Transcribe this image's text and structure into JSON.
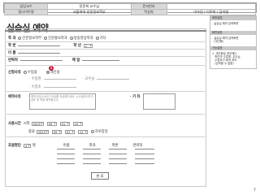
{
  "header": {
    "r1": [
      "담당교수",
      "장윤희 교수님",
      "문서번호",
      ""
    ],
    "r2": [
      "협사이트명",
      "서울여대 인문정보학부",
      "작성자",
      "이수민 / 이주희 / 김미영"
    ]
  },
  "title": "실습실 예약",
  "form": {
    "school_label": "학 과",
    "school_opts": [
      "인문정보학부",
      "인문홍보학과",
      "방송영상학과",
      "기타"
    ],
    "stuno_label": "학 번",
    "grade_label": "학 년",
    "grade_value": "2",
    "name_label": "이 름",
    "phone_label": "연락처",
    "email_label": "메 일",
    "type_label": "신청사유",
    "type_opts": [
      "수업용",
      "개인용"
    ],
    "badge_num": "1",
    "course_label": "· 수업명",
    "prof_label": "· 교수님",
    "course2_label": "· 수업조",
    "reason_label": "예약사유",
    "reason_placeholder": "예약사유(200자 이내)를 작성해주세요. 시스템관리자가 검토 후 최종 예약됩니다.",
    "etc_label": "· 기 타",
    "time_label": "사용시간",
    "start_label": "시작",
    "start_vals": [
      "2013",
      "09",
      "01",
      "10"
    ],
    "end_label": "종료",
    "end_vals": [
      "2013",
      "09",
      "01",
      "12"
    ],
    "allday_label": "하루종일",
    "people_label": "조원명단",
    "people_count": "4",
    "people_unit": "명",
    "people_cols": [
      "이름",
      "학과",
      "학번",
      "연락처"
    ],
    "ok_label": "완 료"
  },
  "side": {
    "h1": "화면설명",
    "b1": "- 실습실 예약 입력화면",
    "h2": "화면설명",
    "b2": "- 실습실 예약 입력화면\n  (개인용)",
    "h3": "기능설명",
    "b3": "1. 개인용일 경우에는\n   학단의 수업명, 교수님,\n   수업조가 회색 처리\n   (입력할 수 없음)"
  },
  "page_number": "7"
}
